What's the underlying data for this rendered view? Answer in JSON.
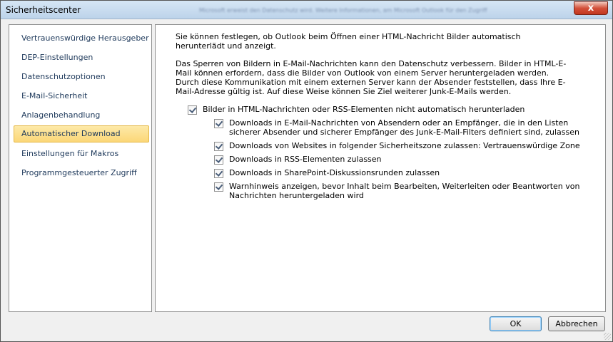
{
  "window": {
    "title": "Sicherheitscenter",
    "title_hint": "Microsoft erweist den Datenschutz wird. Weitere Informationen, am Microsoft Outlook für den Zugriff",
    "close_label": "x"
  },
  "sidebar": {
    "items": [
      {
        "label": "Vertrauenswürdige Herausgeber"
      },
      {
        "label": "DEP-Einstellungen"
      },
      {
        "label": "Datenschutzoptionen"
      },
      {
        "label": "E-Mail-Sicherheit"
      },
      {
        "label": "Anlagenbehandlung"
      },
      {
        "label": "Automatischer Download"
      },
      {
        "label": "Einstellungen für Makros"
      },
      {
        "label": "Programmgesteuerter Zugriff"
      }
    ],
    "active_index": 5
  },
  "main": {
    "intro": "Sie können festlegen, ob Outlook beim Öffnen einer HTML-Nachricht Bilder automatisch herunterlädt und anzeigt.",
    "description": "Das Sperren von Bildern in E-Mail-Nachrichten kann den Datenschutz verbessern. Bilder in HTML-E-Mail können erfordern, dass die Bilder von Outlook von einem Server heruntergeladen werden. Durch diese Kommunikation mit einem externen Server kann der Absender feststellen, dass Ihre E-Mail-Adresse gültig ist. Auf diese Weise können Sie Ziel weiterer Junk-E-Mails werden.",
    "main_checkbox": {
      "label": "Bilder in HTML-Nachrichten oder RSS-Elementen nicht automatisch herunterladen",
      "checked": true
    },
    "sub_checkboxes": [
      {
        "label": "Downloads in E-Mail-Nachrichten von Absendern oder an Empfänger, die in den Listen sicherer Absender und sicherer Empfänger des Junk-E-Mail-Filters definiert sind, zulassen",
        "checked": true
      },
      {
        "label": "Downloads von Websites in folgender Sicherheitszone zulassen: Vertrauenswürdige Zone",
        "checked": true
      },
      {
        "label": "Downloads in RSS-Elementen zulassen",
        "checked": true
      },
      {
        "label": "Downloads in SharePoint-Diskussionsrunden zulassen",
        "checked": true
      },
      {
        "label": "Warnhinweis anzeigen, bevor Inhalt beim Bearbeiten, Weiterleiten oder Beantworten von Nachrichten heruntergeladen wird",
        "checked": true
      }
    ]
  },
  "footer": {
    "ok_label": "OK",
    "cancel_label": "Abbrechen"
  },
  "colors": {
    "accent_selected": "#fbd778",
    "nav_text": "#1e395b",
    "close_red": "#c2371f"
  }
}
